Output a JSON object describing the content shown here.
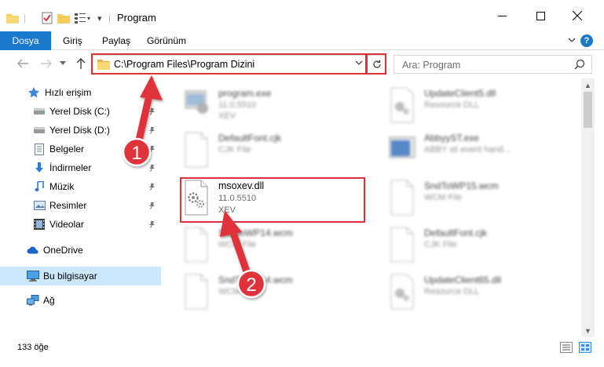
{
  "window": {
    "title": "Program"
  },
  "ribbon": {
    "tabs": [
      "Dosya",
      "Giriş",
      "Paylaş",
      "Görünüm"
    ],
    "help": "?"
  },
  "address": {
    "path": "C:\\Program Files\\Program Dizini"
  },
  "search": {
    "placeholder": "Ara: Program"
  },
  "sidebar": {
    "items": [
      {
        "label": "Hızlı erişim",
        "icon": "star-icon"
      },
      {
        "label": "Yerel Disk (C:)",
        "icon": "drive-icon"
      },
      {
        "label": "Yerel Disk (D:)",
        "icon": "drive-icon"
      },
      {
        "label": "Belgeler",
        "icon": "documents-icon"
      },
      {
        "label": "İndirmeler",
        "icon": "download-icon"
      },
      {
        "label": "Müzik",
        "icon": "music-icon"
      },
      {
        "label": "Resimler",
        "icon": "pictures-icon"
      },
      {
        "label": "Videolar",
        "icon": "videos-icon"
      },
      {
        "label": "OneDrive",
        "icon": "cloud-icon"
      },
      {
        "label": "Bu bilgisayar",
        "icon": "computer-icon"
      },
      {
        "label": "Ağ",
        "icon": "network-icon"
      }
    ]
  },
  "files": [
    {
      "name": "program.exe",
      "meta1": "11.0.5510",
      "meta2": "XEV"
    },
    {
      "name": "UpdateClient5.dll",
      "meta1": "Resource DLL",
      "meta2": ""
    },
    {
      "name": "DefaultFont.cjk",
      "meta1": "CJK File",
      "meta2": ""
    },
    {
      "name": "AbbyyST.exe",
      "meta1": "ABBY sti event hand...",
      "meta2": ""
    },
    {
      "name": "msoxev.dll",
      "meta1": "11.0.5510",
      "meta2": "XEV"
    },
    {
      "name": "SndToWP15.wcm",
      "meta1": "WCM File",
      "meta2": ""
    },
    {
      "name": "SndToWP14.wcm",
      "meta1": "WCM File",
      "meta2": ""
    },
    {
      "name": "DefaultFont.cjk",
      "meta1": "CJK File",
      "meta2": ""
    },
    {
      "name": "SndToWP14.wcm",
      "meta1": "WCM File",
      "meta2": ""
    },
    {
      "name": "UpdateClient65.dll",
      "meta1": "Resource DLL",
      "meta2": ""
    }
  ],
  "annotations": {
    "step1": "1",
    "step2": "2"
  },
  "status": {
    "count": "133 öğe"
  },
  "colors": {
    "accent": "#1979ca",
    "highlight": "#e0313a",
    "selected": "#cce8ff"
  }
}
